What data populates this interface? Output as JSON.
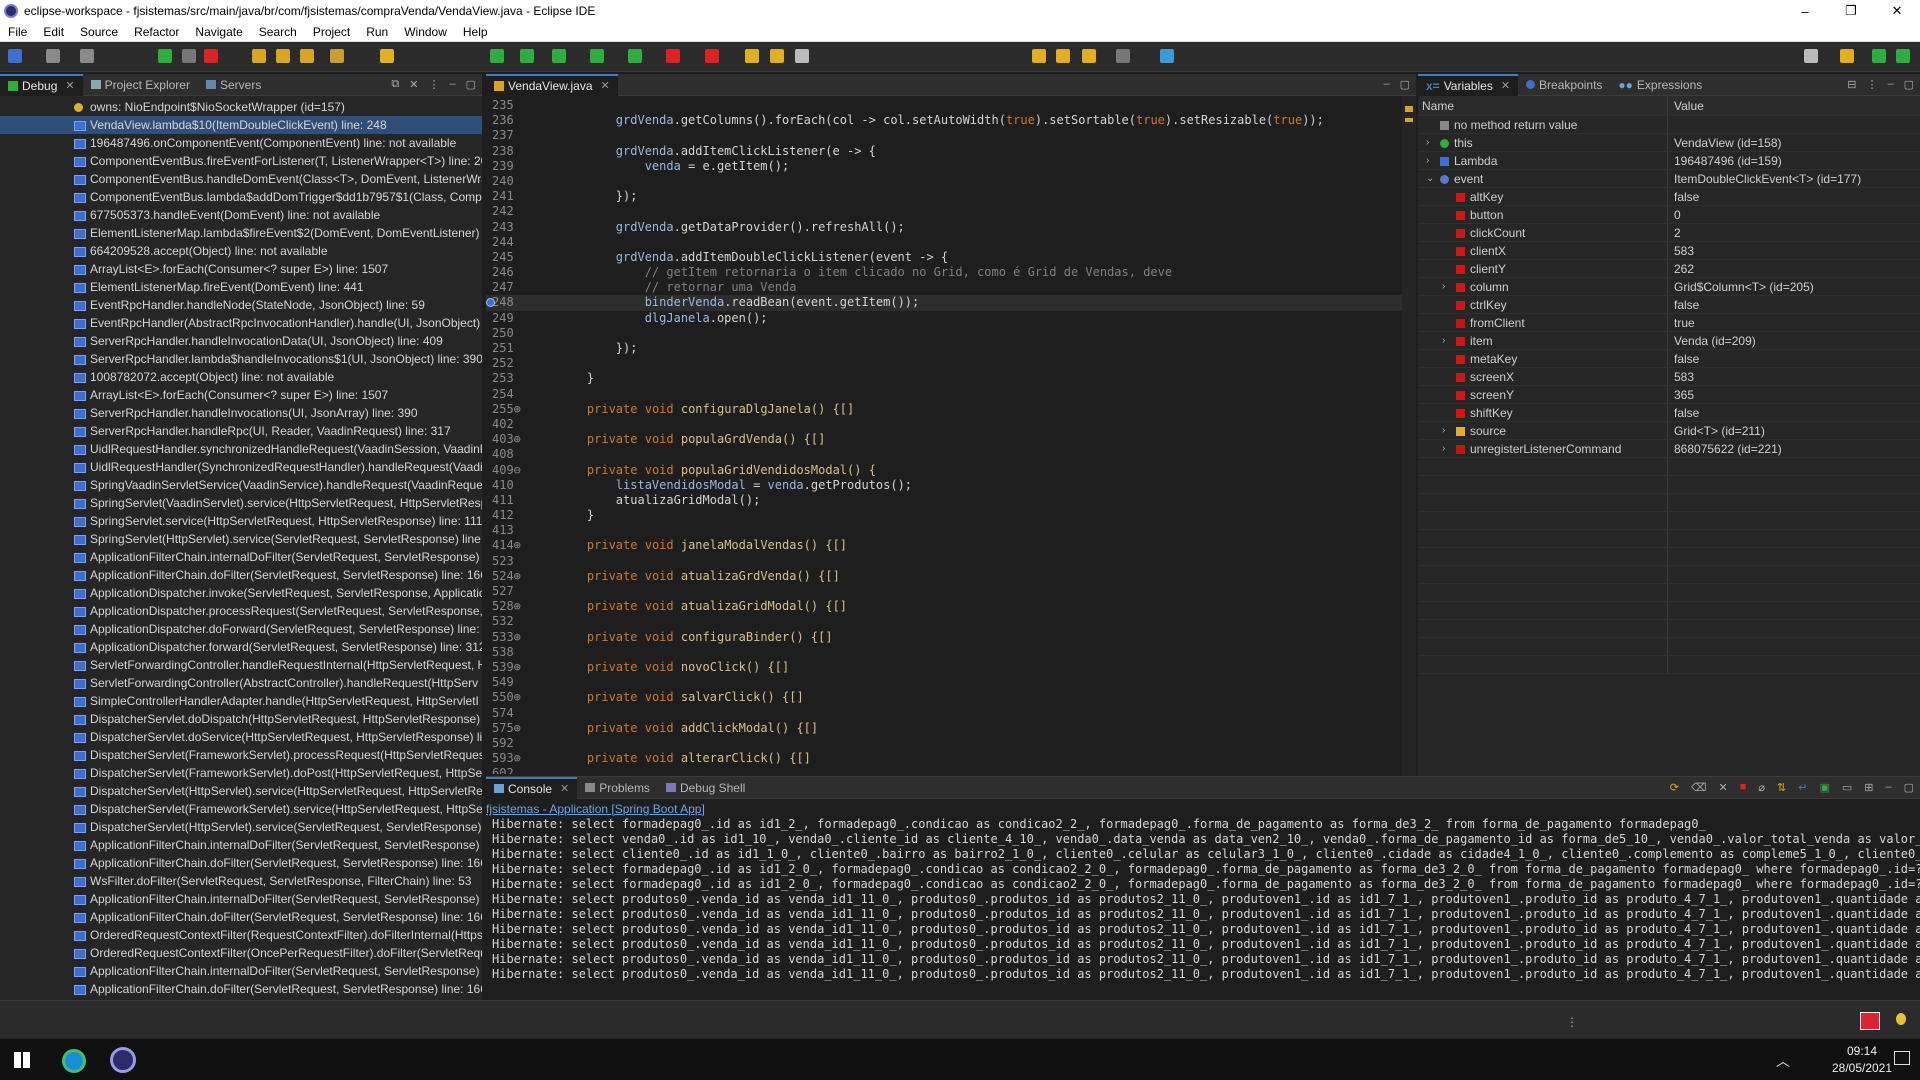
{
  "window": {
    "title": "eclipse-workspace - fjsistemas/src/main/java/br/com/fjsistemas/compraVenda/VendaView.java - Eclipse IDE",
    "minimize": "–",
    "maximize": "❐",
    "close": "✕"
  },
  "menu": [
    "File",
    "Edit",
    "Source",
    "Refactor",
    "Navigate",
    "Search",
    "Project",
    "Run",
    "Window",
    "Help"
  ],
  "debug_panel": {
    "tabs": [
      {
        "label": "Debug",
        "active": true
      },
      {
        "label": "Project Explorer",
        "active": false
      },
      {
        "label": "Servers",
        "active": false
      }
    ],
    "frames": [
      "owns: NioEndpoint$NioSocketWrapper  (id=157)",
      "VendaView.lambda$10(ItemDoubleClickEvent) line: 248",
      "196487496.onComponentEvent(ComponentEvent) line: not available",
      "ComponentEventBus.fireEventForListener(T, ListenerWrapper<T>) line: 205",
      "ComponentEventBus.handleDomEvent(Class<T>, DomEvent, ListenerWrapper<T>)",
      "ComponentEventBus.lambda$addDomTrigger$dd1b7957$1(Class, Component",
      "677505373.handleEvent(DomEvent) line: not available",
      "ElementListenerMap.lambda$fireEvent$2(DomEvent, DomEventListener) line",
      "664209528.accept(Object) line: not available",
      "ArrayList<E>.forEach(Consumer<? super E>) line: 1507",
      "ElementListenerMap.fireEvent(DomEvent) line: 441",
      "EventRpcHandler.handleNode(StateNode, JsonObject) line: 59",
      "EventRpcHandler(AbstractRpcInvocationHandler).handle(UI, JsonObject)",
      "ServerRpcHandler.handleInvocationData(UI, JsonObject) line: 409",
      "ServerRpcHandler.lambda$handleInvocations$1(UI, JsonObject) line: 390",
      "1008782072.accept(Object) line: not available",
      "ArrayList<E>.forEach(Consumer<? super E>) line: 1507",
      "ServerRpcHandler.handleInvocations(UI, JsonArray) line: 390",
      "ServerRpcHandler.handleRpc(UI, Reader, VaadinRequest) line: 317",
      "UidlRequestHandler.synchronizedHandleRequest(VaadinSession, VaadinR",
      "UidlRequestHandler(SynchronizedRequestHandler).handleRequest(Vaadi",
      "SpringVaadinServletService(VaadinService).handleRequest(VaadinRequest,",
      "SpringServlet(VaadinServlet).service(HttpServletRequest, HttpServletResp",
      "SpringServlet.service(HttpServletRequest, HttpServletResponse) line: 111",
      "SpringServlet(HttpServlet).service(ServletRequest, ServletResponse) line: 7",
      "ApplicationFilterChain.internalDoFilter(ServletRequest, ServletResponse) l",
      "ApplicationFilterChain.doFilter(ServletRequest, ServletResponse) line: 166",
      "ApplicationDispatcher.invoke(ServletRequest, ServletResponse, Applicatic",
      "ApplicationDispatcher.processRequest(ServletRequest, ServletResponse, A",
      "ApplicationDispatcher.doForward(ServletRequest, ServletResponse) line: 3",
      "ApplicationDispatcher.forward(ServletRequest, ServletResponse) line: 312",
      "ServletForwardingController.handleRequestInternal(HttpServletRequest, H",
      "ServletForwardingController(AbstractController).handleRequest(HttpServ",
      "SimpleControllerHandlerAdapter.handle(HttpServletRequest, HttpServletI",
      "DispatcherServlet.doDispatch(HttpServletRequest, HttpServletResponse) l",
      "DispatcherServlet.doService(HttpServletRequest, HttpServletResponse) lin",
      "DispatcherServlet(FrameworkServlet).processRequest(HttpServletRequest,",
      "DispatcherServlet(FrameworkServlet).doPost(HttpServletRequest, HttpSer",
      "DispatcherServlet(HttpServlet).service(HttpServletRequest, HttpServletRes",
      "DispatcherServlet(FrameworkServlet).service(HttpServletRequest, HttpSer",
      "DispatcherServlet(HttpServlet).service(ServletRequest, ServletResponse) li",
      "ApplicationFilterChain.internalDoFilter(ServletRequest, ServletResponse) l",
      "ApplicationFilterChain.doFilter(ServletRequest, ServletResponse) line: 166",
      "WsFilter.doFilter(ServletRequest, ServletResponse, FilterChain) line: 53",
      "ApplicationFilterChain.internalDoFilter(ServletRequest, ServletResponse) l",
      "ApplicationFilterChain.doFilter(ServletRequest, ServletResponse) line: 166",
      "OrderedRequestContextFilter(RequestContextFilter).doFilterInternal(Https",
      "OrderedRequestContextFilter(OncePerRequestFilter).doFilter(ServletRequ",
      "ApplicationFilterChain.internalDoFilter(ServletRequest, ServletResponse) l",
      "ApplicationFilterChain.doFilter(ServletRequest, ServletResponse) line: 166"
    ]
  },
  "editor": {
    "tab": "VendaView.java",
    "lines": [
      {
        "n": "235",
        "t": ""
      },
      {
        "n": "236",
        "t": "        grdVenda.getColumns().forEach(col -> col.setAutoWidth(true).setSortable(true).setResizable(true));"
      },
      {
        "n": "237",
        "t": ""
      },
      {
        "n": "238",
        "t": "        grdVenda.addItemClickListener(e -> {"
      },
      {
        "n": "239",
        "t": "            venda = e.getItem();"
      },
      {
        "n": "240",
        "t": ""
      },
      {
        "n": "241",
        "t": "        });"
      },
      {
        "n": "242",
        "t": ""
      },
      {
        "n": "243",
        "t": "        grdVenda.getDataProvider().refreshAll();"
      },
      {
        "n": "244",
        "t": ""
      },
      {
        "n": "245",
        "t": "        grdVenda.addItemDoubleClickListener(event -> {"
      },
      {
        "n": "246",
        "t": "            // getItem retornaria o item clicado no Grid, como é Grid de Vendas, deve"
      },
      {
        "n": "247",
        "t": "            // retornar uma Venda"
      },
      {
        "n": "248",
        "t": "            binderVenda.readBean(event.getItem());"
      },
      {
        "n": "249",
        "t": "            dlgJanela.open();"
      },
      {
        "n": "250",
        "t": ""
      },
      {
        "n": "251",
        "t": "        });"
      },
      {
        "n": "252",
        "t": ""
      },
      {
        "n": "253",
        "t": "    }"
      },
      {
        "n": "254",
        "t": ""
      },
      {
        "n": "255⊕",
        "t": "    private void configuraDlgJanela() {[]"
      },
      {
        "n": "402",
        "t": ""
      },
      {
        "n": "403⊕",
        "t": "    private void populaGrdVenda() {[]"
      },
      {
        "n": "408",
        "t": ""
      },
      {
        "n": "409⊖",
        "t": "    private void populaGridVendidosModal() {"
      },
      {
        "n": "410",
        "t": "        listaVendidosModal = venda.getProdutos();"
      },
      {
        "n": "411",
        "t": "        atualizaGridModal();"
      },
      {
        "n": "412",
        "t": "    }"
      },
      {
        "n": "413",
        "t": ""
      },
      {
        "n": "414⊕",
        "t": "    private void janelaModalVendas() {[]"
      },
      {
        "n": "523",
        "t": ""
      },
      {
        "n": "524⊕",
        "t": "    private void atualizaGrdVenda() {[]"
      },
      {
        "n": "527",
        "t": ""
      },
      {
        "n": "528⊕",
        "t": "    private void atualizaGridModal() {[]"
      },
      {
        "n": "532",
        "t": ""
      },
      {
        "n": "533⊕",
        "t": "    private void configuraBinder() {[]"
      },
      {
        "n": "538",
        "t": ""
      },
      {
        "n": "539⊕",
        "t": "    private void novoClick() {[]"
      },
      {
        "n": "549",
        "t": ""
      },
      {
        "n": "550⊕",
        "t": "    private void salvarClick() {[]"
      },
      {
        "n": "574",
        "t": ""
      },
      {
        "n": "575⊕",
        "t": "    private void addClickModal() {[]"
      },
      {
        "n": "592",
        "t": ""
      },
      {
        "n": "593⊕",
        "t": "    private void alterarClick() {[]"
      },
      {
        "n": "602",
        "t": ""
      }
    ]
  },
  "variables_panel": {
    "tabs": [
      {
        "label": "Variables",
        "active": true
      },
      {
        "label": "Breakpoints",
        "active": false
      },
      {
        "label": "Expressions",
        "active": false
      }
    ],
    "col_name": "Name",
    "col_value": "Value",
    "rows": [
      {
        "name": "no method return value",
        "value": "",
        "indent": 0,
        "icon": "#888888",
        "arrow": ""
      },
      {
        "name": "this",
        "value": "VendaView  (id=158)",
        "indent": 0,
        "icon": "#2eae3c",
        "arrow": "›"
      },
      {
        "name": "Lambda",
        "value": "196487496  (id=159)",
        "indent": 0,
        "icon": "#3b6fd0",
        "arrow": "›"
      },
      {
        "name": "event",
        "value": "ItemDoubleClickEvent<T>  (id=177)",
        "indent": 0,
        "icon": "#5a78d0",
        "arrow": "⌄"
      },
      {
        "name": "altKey",
        "value": "false",
        "indent": 1,
        "icon": "#d11",
        "arrow": ""
      },
      {
        "name": "button",
        "value": "0",
        "indent": 1,
        "icon": "#d11",
        "arrow": ""
      },
      {
        "name": "clickCount",
        "value": "2",
        "indent": 1,
        "icon": "#d11",
        "arrow": ""
      },
      {
        "name": "clientX",
        "value": "583",
        "indent": 1,
        "icon": "#d11",
        "arrow": ""
      },
      {
        "name": "clientY",
        "value": "262",
        "indent": 1,
        "icon": "#d11",
        "arrow": ""
      },
      {
        "name": "column",
        "value": "Grid$Column<T>  (id=205)",
        "indent": 1,
        "icon": "#d11",
        "arrow": "›"
      },
      {
        "name": "ctrlKey",
        "value": "false",
        "indent": 1,
        "icon": "#d11",
        "arrow": ""
      },
      {
        "name": "fromClient",
        "value": "true",
        "indent": 1,
        "icon": "#c11",
        "arrow": ""
      },
      {
        "name": "item",
        "value": "Venda  (id=209)",
        "indent": 1,
        "icon": "#d11",
        "arrow": "›"
      },
      {
        "name": "metaKey",
        "value": "false",
        "indent": 1,
        "icon": "#d11",
        "arrow": ""
      },
      {
        "name": "screenX",
        "value": "583",
        "indent": 1,
        "icon": "#d11",
        "arrow": ""
      },
      {
        "name": "screenY",
        "value": "365",
        "indent": 1,
        "icon": "#d11",
        "arrow": ""
      },
      {
        "name": "shiftKey",
        "value": "false",
        "indent": 1,
        "icon": "#d11",
        "arrow": ""
      },
      {
        "name": "source",
        "value": "Grid<T>  (id=211)",
        "indent": 1,
        "icon": "#e0b020",
        "arrow": "›"
      },
      {
        "name": "unregisterListenerCommand",
        "value": "868075622  (id=221)",
        "indent": 1,
        "icon": "#c11",
        "arrow": "›"
      }
    ]
  },
  "console": {
    "tabs": [
      {
        "label": "Console",
        "active": true
      },
      {
        "label": "Problems",
        "active": false
      },
      {
        "label": "Debug Shell",
        "active": false
      }
    ],
    "process": "fjsistemas - Application [Spring Boot App]",
    "lines": [
      "Hibernate: select formadepag0_.id as id1_2_, formadepag0_.condicao as condicao2_2_, formadepag0_.forma_de_pagamento as forma_de3_2_ from forma_de_pagamento formadepag0_",
      "Hibernate: select venda0_.id as id1_10_, venda0_.cliente_id as cliente_4_10_, venda0_.data_venda as data_ven2_10_, venda0_.forma_de_pagamento_id as forma_de5_10_, venda0_.valor_total_venda as valor_to3_10",
      "Hibernate: select cliente0_.id as id1_1_0_, cliente0_.bairro as bairro2_1_0_, cliente0_.celular as celular3_1_0_, cliente0_.cidade as cidade4_1_0_, cliente0_.complemento as compleme5_1_0_, cliente0_.cpf a",
      "Hibernate: select formadepag0_.id as id1_2_0_, formadepag0_.condicao as condicao2_2_0_, formadepag0_.forma_de_pagamento as forma_de3_2_0_ from forma_de_pagamento formadepag0_ where formadepag0_.id=?",
      "Hibernate: select formadepag0_.id as id1_2_0_, formadepag0_.condicao as condicao2_2_0_, formadepag0_.forma_de_pagamento as forma_de3_2_0_ from forma_de_pagamento formadepag0_ where formadepag0_.id=?",
      "Hibernate: select produtos0_.venda_id as venda_id1_11_0_, produtos0_.produtos_id as produtos2_11_0_, produtoven1_.id as id1_7_1_, produtoven1_.produto_id as produto_4_7_1_, produtoven1_.quantidade as quar",
      "Hibernate: select produtos0_.venda_id as venda_id1_11_0_, produtos0_.produtos_id as produtos2_11_0_, produtoven1_.id as id1_7_1_, produtoven1_.produto_id as produto_4_7_1_, produtoven1_.quantidade as quar",
      "Hibernate: select produtos0_.venda_id as venda_id1_11_0_, produtos0_.produtos_id as produtos2_11_0_, produtoven1_.id as id1_7_1_, produtoven1_.produto_id as produto_4_7_1_, produtoven1_.quantidade as quar",
      "Hibernate: select produtos0_.venda_id as venda_id1_11_0_, produtos0_.produtos_id as produtos2_11_0_, produtoven1_.id as id1_7_1_, produtoven1_.produto_id as produto_4_7_1_, produtoven1_.quantidade as quar",
      "Hibernate: select produtos0_.venda_id as venda_id1_11_0_, produtos0_.produtos_id as produtos2_11_0_, produtoven1_.id as id1_7_1_, produtoven1_.produto_id as produto_4_7_1_, produtoven1_.quantidade as quar",
      "Hibernate: select produtos0_.venda_id as venda_id1_11_0_, produtos0_.produtos_id as produtos2_11_0_, produtoven1_.id as id1_7_1_, produtoven1_.produto_id as produto_4_7_1_, produtoven1_.quantidade as quar"
    ]
  },
  "taskbar": {
    "time": "09:14",
    "date": "28/05/2021"
  },
  "colors": {
    "accent": "#3e7fbf",
    "selection": "#2f4f7a",
    "keyword": "#cc7832",
    "comment": "#808080"
  }
}
